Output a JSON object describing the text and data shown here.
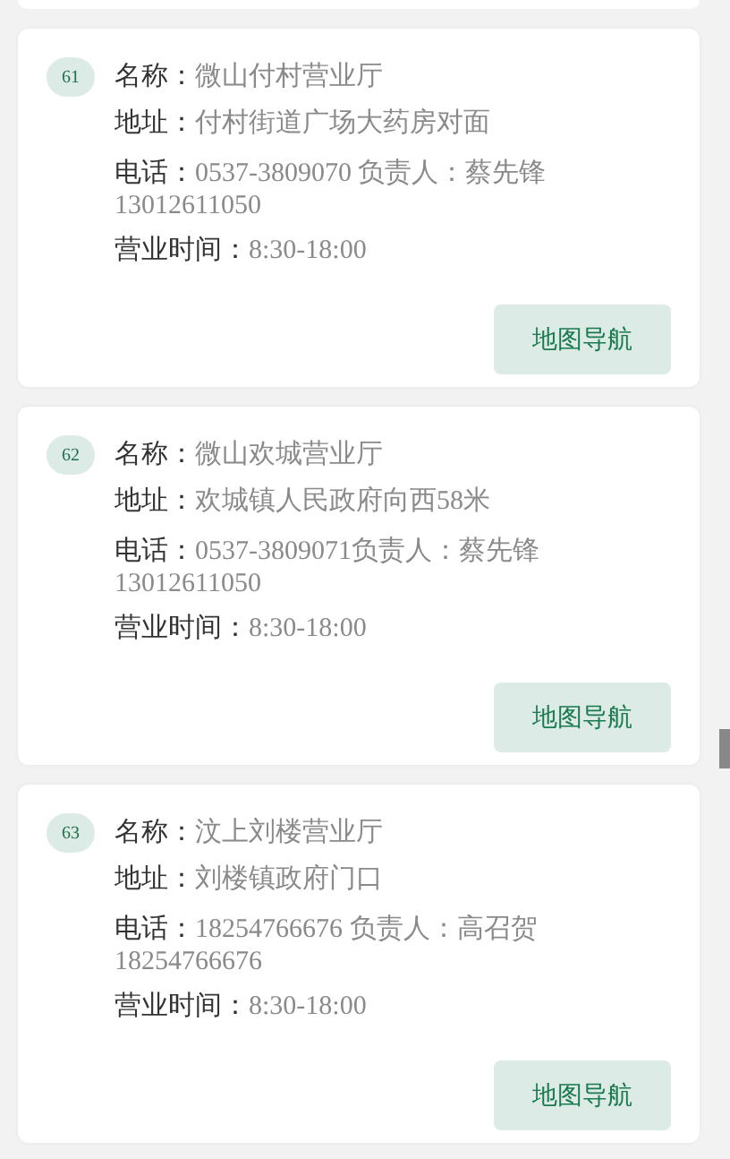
{
  "stores": [
    {
      "index": "61",
      "fields": [
        {
          "label": "名称：",
          "value": "微山付村营业厅"
        },
        {
          "label": "地址：",
          "value": "付村街道广场大药房对面"
        },
        {
          "label": "电话：",
          "value": "0537-3809070 负责人：蔡先锋",
          "continuation": "13012611050"
        },
        {
          "label": "营业时间：",
          "value": "8:30-18:00"
        }
      ],
      "button": "地图导航"
    },
    {
      "index": "62",
      "fields": [
        {
          "label": "名称：",
          "value": "微山欢城营业厅"
        },
        {
          "label": "地址：",
          "value": "欢城镇人民政府向西58米"
        },
        {
          "label": "电话：",
          "value": "0537-3809071负责人：蔡先锋",
          "continuation": "13012611050"
        },
        {
          "label": "营业时间：",
          "value": "8:30-18:00"
        }
      ],
      "button": "地图导航"
    },
    {
      "index": "63",
      "fields": [
        {
          "label": "名称：",
          "value": "汶上刘楼营业厅"
        },
        {
          "label": "地址：",
          "value": "刘楼镇政府门口"
        },
        {
          "label": "电话：",
          "value": "18254766676 负责人：高召贺",
          "continuation": "18254766676"
        },
        {
          "label": "营业时间：",
          "value": "8:30-18:00"
        }
      ],
      "button": "地图导航"
    }
  ]
}
